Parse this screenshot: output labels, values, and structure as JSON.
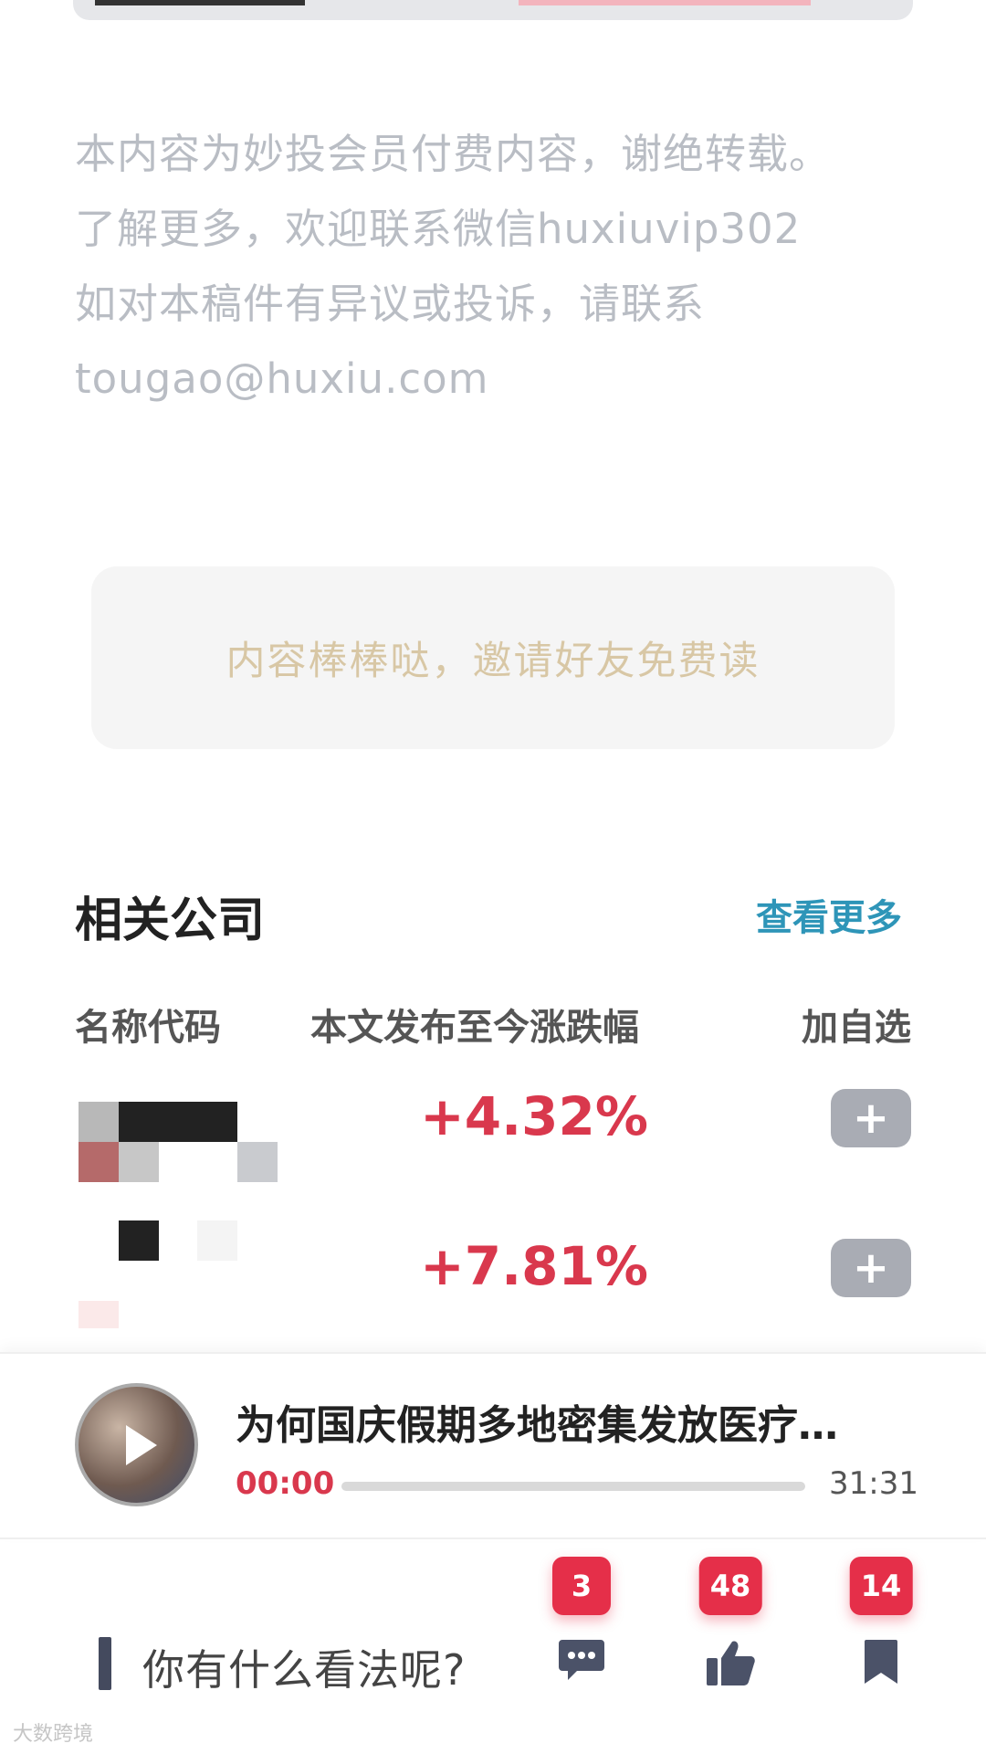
{
  "disclaimer": {
    "line1": "本内容为妙投会员付费内容，谢绝转载。",
    "line2": "了解更多，欢迎联系微信huxiuvip302",
    "line3": "如对本稿件有异议或投诉，请联系",
    "line4": "tougao@huxiu.com"
  },
  "invite": {
    "label": "内容棒棒哒，邀请好友免费读"
  },
  "related": {
    "title": "相关公司",
    "view_more": "查看更多",
    "columns": {
      "name": "名称代码",
      "change": "本文发布至今涨跌幅",
      "add": "加自选"
    },
    "rows": [
      {
        "change": "+4.32%",
        "add_label": "+"
      },
      {
        "change": "+7.81%",
        "add_label": "+"
      }
    ]
  },
  "player": {
    "title": "为何国庆假期多地密集发放医疗…",
    "current_time": "00:00",
    "total_time": "31:31",
    "progress": 0
  },
  "actions": {
    "comment_placeholder": "你有什么看法呢?",
    "comment_count": "3",
    "like_count": "48",
    "bookmark_count": "14"
  },
  "watermark": "大数跨境",
  "colors": {
    "accent_red": "#d9384d",
    "link_blue": "#2e95b8",
    "invite_gold": "#d8c7a5"
  }
}
